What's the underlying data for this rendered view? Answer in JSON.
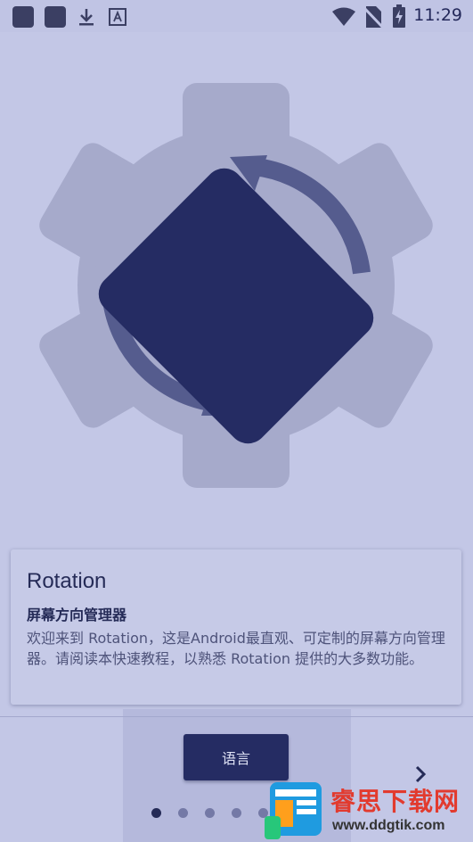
{
  "status_bar": {
    "time": "11:29"
  },
  "card": {
    "title": "Rotation",
    "subtitle": "屏幕方向管理器",
    "body": "欢迎来到 Rotation，这是Android最直观、可定制的屏幕方向管理器。请阅读本快速教程，以熟悉 Rotation 提供的大多数功能。"
  },
  "bottom": {
    "language_button": "语言",
    "page_count": 5,
    "current_page": 1
  },
  "watermark": {
    "text": "睿思下载网",
    "url": "www.ddgtik.com"
  },
  "colors": {
    "background": "#c3c7e6",
    "gear": "#a6aacb",
    "phone": "#252c63",
    "arrows": "#555c8e",
    "button": "#252c63"
  }
}
